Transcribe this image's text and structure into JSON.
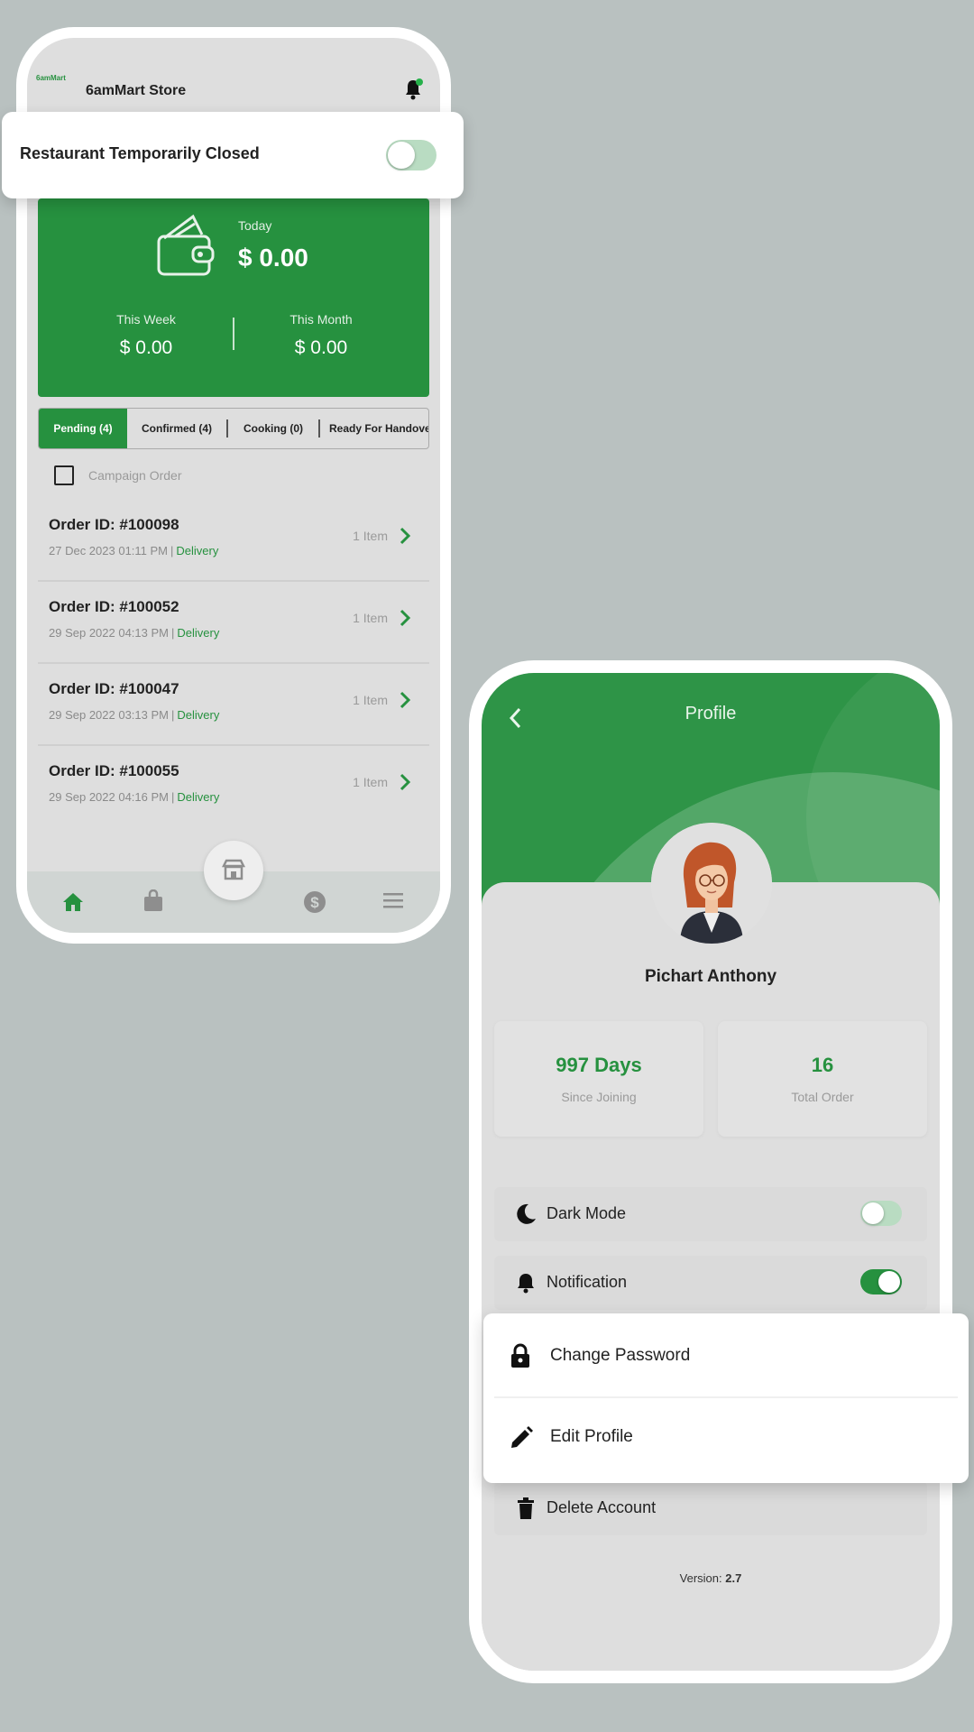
{
  "store": {
    "logo_text": "6amMart",
    "name": "6amMart Store",
    "closed_banner_label": "Restaurant Temporarily Closed",
    "closed_toggle_on": false
  },
  "earnings": {
    "today_label": "Today",
    "today_value": "$ 0.00",
    "week_label": "This Week",
    "week_value": "$ 0.00",
    "month_label": "This Month",
    "month_value": "$ 0.00"
  },
  "tabs": [
    {
      "label": "Pending (4)",
      "active": true
    },
    {
      "label": "Confirmed (4)",
      "active": false
    },
    {
      "label": "Cooking (0)",
      "active": false
    },
    {
      "label": "Ready For Handove",
      "active": false
    }
  ],
  "campaign_label": "Campaign Order",
  "orders": [
    {
      "id": "Order ID: #100098",
      "date": "27 Dec 2023  01:11 PM",
      "type": "Delivery",
      "items": "1 Item"
    },
    {
      "id": "Order ID: #100052",
      "date": "29 Sep 2022  04:13 PM",
      "type": "Delivery",
      "items": "1 Item"
    },
    {
      "id": "Order ID: #100047",
      "date": "29 Sep 2022  03:13 PM",
      "type": "Delivery",
      "items": "1 Item"
    },
    {
      "id": "Order ID: #100055",
      "date": "29 Sep 2022  04:16 PM",
      "type": "Delivery",
      "items": "1 Item"
    }
  ],
  "bottom_nav": [
    "home-icon",
    "bag-icon",
    "store-icon",
    "dollar-icon",
    "menu-icon"
  ],
  "profile": {
    "title": "Profile",
    "name": "Pichart Anthony",
    "days_value": "997 Days",
    "days_label": "Since Joining",
    "orders_value": "16",
    "orders_label": "Total Order",
    "dark_mode_label": "Dark Mode",
    "dark_mode_on": false,
    "notification_label": "Notification",
    "notification_on": true,
    "change_password_label": "Change Password",
    "edit_profile_label": "Edit Profile",
    "delete_account_label": "Delete Account",
    "version_label": "Version:",
    "version_value": "2.7"
  },
  "colors": {
    "brand_green": "#26913f",
    "background": "#b9c1c0"
  }
}
